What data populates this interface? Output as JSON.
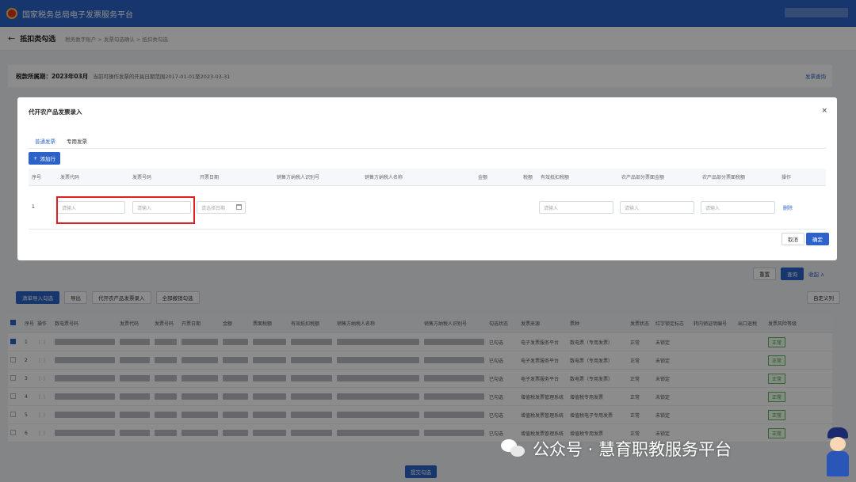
{
  "app": {
    "title": "国家税务总局电子发票服务平台"
  },
  "breadcrumb": {
    "page_title": "抵扣类勾选",
    "trail": "税务数字账户 > 发票勾选确认 > 抵扣类勾选"
  },
  "period": {
    "label": "税款所属期：2023年03月",
    "range": "当前可操作发票的开具日期范围2017-01-01至2023-03-31",
    "right_link": "发票查询"
  },
  "toolbar": {
    "reset": "重置",
    "query": "查询",
    "collapse": "收起 ∧",
    "column_settings": "自定义列"
  },
  "actions": [
    "清单导入勾选",
    "导出",
    "代开农产品发票录入",
    "全部撤销勾选"
  ],
  "grid": {
    "headers": [
      "序号",
      "操作",
      "数电票号码",
      "发票代码",
      "发票号码",
      "开票日期",
      "金额",
      "票面税额",
      "有效抵扣税额",
      "销售方纳税人名称",
      "销售方纳税人识别号",
      "勾选状态",
      "发票来源",
      "票种",
      "发票状态",
      "红字锁定标志",
      "转内销证明编号",
      "出口退税",
      "发票风险等级"
    ],
    "rows": [
      {
        "no": "1",
        "checked": true,
        "status": "已勾选",
        "source": "电子发票服务平台",
        "type": "数电票（专用发票）",
        "state": "正常",
        "lock": "未锁定",
        "risk": "正常"
      },
      {
        "no": "2",
        "checked": false,
        "status": "已勾选",
        "source": "电子发票服务平台",
        "type": "数电票（专用发票）",
        "state": "正常",
        "lock": "未锁定",
        "risk": "正常"
      },
      {
        "no": "3",
        "checked": false,
        "status": "已勾选",
        "source": "电子发票服务平台",
        "type": "数电票（专用发票）",
        "state": "正常",
        "lock": "未锁定",
        "risk": "正常"
      },
      {
        "no": "4",
        "checked": false,
        "status": "已勾选",
        "source": "增值税发票管理系统",
        "type": "增值税专用发票",
        "state": "正常",
        "lock": "未锁定",
        "risk": "正常"
      },
      {
        "no": "5",
        "checked": false,
        "status": "已勾选",
        "source": "增值税发票管理系统",
        "type": "增值税电子专用发票",
        "state": "正常",
        "lock": "未锁定",
        "risk": "正常"
      },
      {
        "no": "6",
        "checked": false,
        "status": "已勾选",
        "source": "增值税发票管理系统",
        "type": "增值税专用发票",
        "state": "正常",
        "lock": "未锁定",
        "risk": "正常"
      }
    ]
  },
  "bottom": {
    "submit": "提交勾选"
  },
  "watermark": {
    "text": "公众号 · 慧育职教服务平台"
  },
  "modal": {
    "title": "代开农产品发票录入",
    "close": "×",
    "tabs": [
      "普通发票",
      "专用发票"
    ],
    "add_row": "添加行",
    "columns": [
      "序号",
      "发票代码",
      "发票号码",
      "开票日期",
      "销售方纳税人识别号",
      "销售方纳税人名称",
      "金额",
      "税额",
      "有效抵扣税额",
      "农产品部分票面金额",
      "农产品部分票面税额",
      "操作"
    ],
    "row": {
      "no": "1",
      "ph_input": "请输入",
      "ph_date": "请选择日期",
      "delete": "删除"
    },
    "cancel": "取消",
    "confirm": "确定"
  },
  "colors": {
    "primary": "#2d63c8",
    "highlight": "#e02020",
    "ok_tag": "#3a9b3a"
  }
}
